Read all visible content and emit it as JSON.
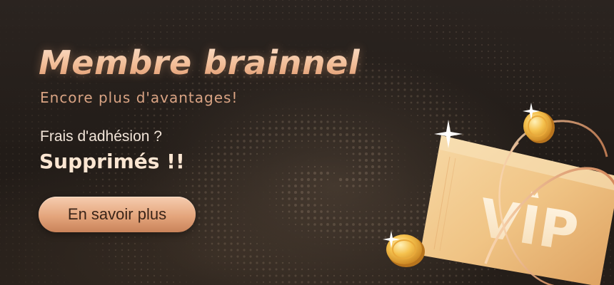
{
  "banner": {
    "title": "Membre brainnel",
    "subtitle": "Encore plus d'avantages!",
    "question": "Frais d'adhésion ?",
    "highlight": "Supprimés !!",
    "cta_label": "En savoir plus",
    "card_label": "VIP"
  },
  "colors": {
    "background": "#231d19",
    "accent": "#e4a57c",
    "title_gradient_top": "#fbe3cf",
    "title_gradient_bottom": "#d98e63",
    "subtitle": "#d9a383",
    "text_light": "#f1e4d8",
    "card_gold": "#f3c98f"
  },
  "icons": {
    "card": "vip-card-icon",
    "coin": "gold-coin-icon",
    "sparkle": "sparkle-icon",
    "crown": "crown-icon"
  }
}
